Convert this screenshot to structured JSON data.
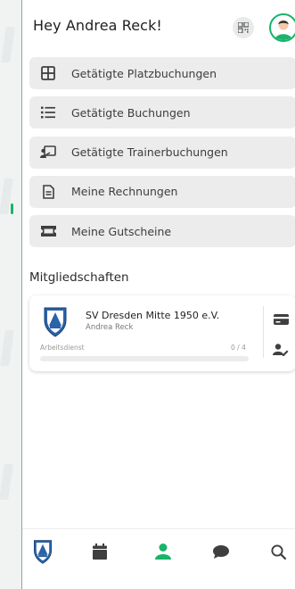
{
  "header": {
    "greeting": "Hey Andrea Reck!"
  },
  "menu": [
    {
      "label": "Getätigte Platzbuchungen",
      "icon": "grid-icon"
    },
    {
      "label": "Getätigte Buchungen",
      "icon": "list-icon"
    },
    {
      "label": "Getätigte Trainerbuchungen",
      "icon": "trainer-board-icon"
    },
    {
      "label": "Meine Rechnungen",
      "icon": "invoice-icon"
    },
    {
      "label": "Meine Gutscheine",
      "icon": "voucher-icon"
    }
  ],
  "memberships": {
    "title": "Mitgliedschaften",
    "card": {
      "club_name": "SV Dresden Mitte 1950 e.V.",
      "member_name": "Andrea Reck",
      "duty_label": "Arbeitsdienst",
      "duty_count": "0 / 4",
      "progress": 0
    }
  },
  "bottom_nav": [
    {
      "icon": "club-logo-icon",
      "active": false
    },
    {
      "icon": "calendar-icon",
      "active": false
    },
    {
      "icon": "profile-icon",
      "active": true
    },
    {
      "icon": "chat-icon",
      "active": false
    },
    {
      "icon": "search-icon",
      "active": false
    }
  ],
  "colors": {
    "accent": "#19b46a",
    "icon": "#3f3f3f",
    "menu_bg": "#ececec"
  }
}
